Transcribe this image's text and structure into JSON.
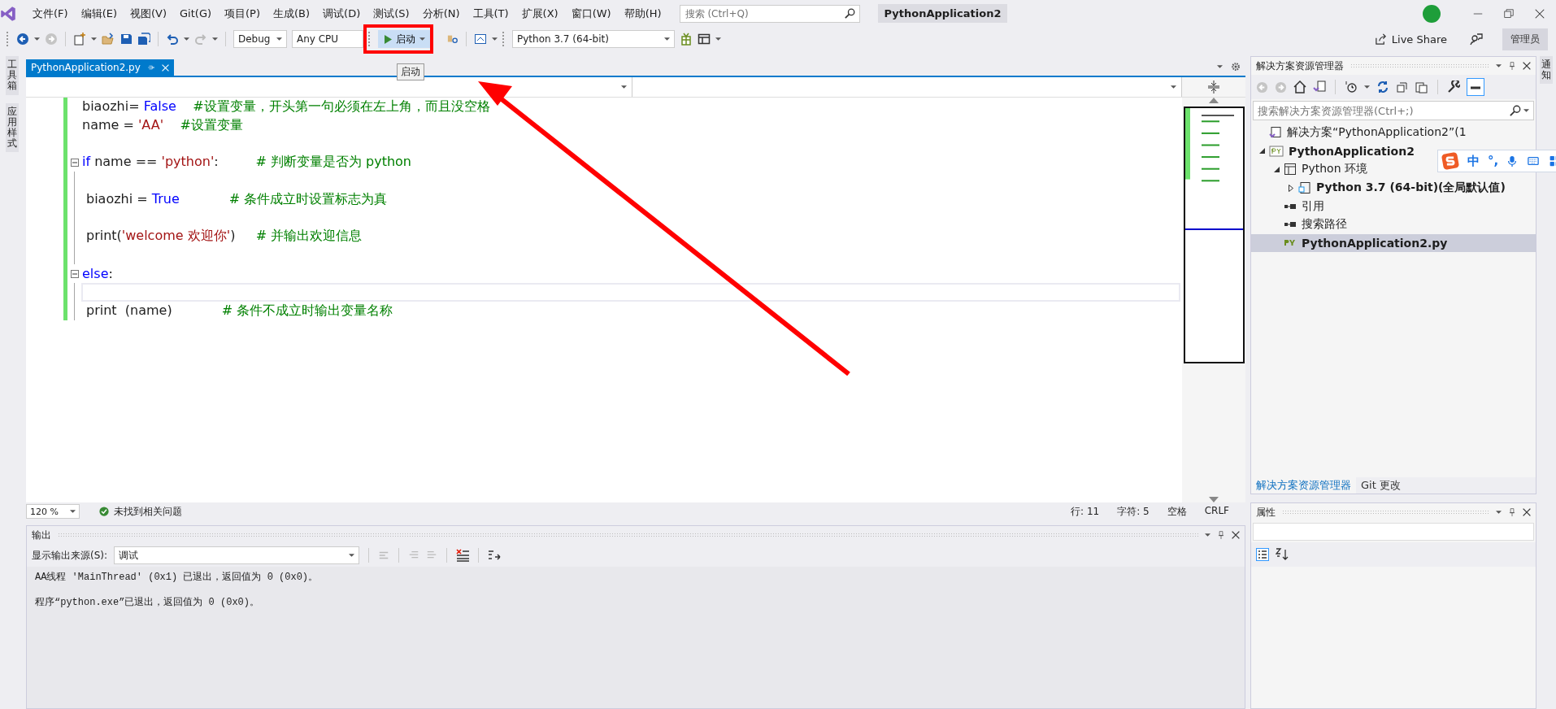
{
  "menu": [
    "文件(F)",
    "编辑(E)",
    "视图(V)",
    "Git(G)",
    "项目(P)",
    "生成(B)",
    "调试(D)",
    "测试(S)",
    "分析(N)",
    "工具(T)",
    "扩展(X)",
    "窗口(W)",
    "帮助(H)"
  ],
  "search": {
    "placeholder": "搜索 (Ctrl+Q)"
  },
  "window": {
    "title": "PythonApplication2"
  },
  "account": {
    "live_share": "Live Share",
    "admin": "管理员"
  },
  "toolbar": {
    "configuration": "Debug",
    "platform": "Any CPU",
    "start": "启动",
    "environment": "Python 3.7 (64-bit)"
  },
  "tooltip": "启动",
  "left_strip": [
    "工具箱",
    "应用样式"
  ],
  "right_strip": [
    "通知"
  ],
  "editor": {
    "tabs": [
      {
        "label": "PythonApplication2.py",
        "selected": true
      }
    ],
    "lines": [
      {
        "current": false,
        "fold": false,
        "block": false,
        "tokens": [
          {
            "kind": "plain",
            "text": "biaozhi= "
          },
          {
            "kind": "keyword",
            "text": "False"
          },
          {
            "kind": "comment",
            "text": "    #设置变量，开头第一句必须在左上角，而且没空格"
          }
        ]
      },
      {
        "current": false,
        "fold": false,
        "block": false,
        "tokens": [
          {
            "kind": "plain",
            "text": "name = "
          },
          {
            "kind": "string",
            "text": "'AA'"
          },
          {
            "kind": "comment",
            "text": "    #设置变量"
          }
        ]
      },
      {
        "current": false,
        "fold": false,
        "block": false
      },
      {
        "current": false,
        "fold": true,
        "block": false,
        "tokens": [
          {
            "kind": "keyword",
            "text": "if"
          },
          {
            "kind": "plain",
            "text": " name == "
          },
          {
            "kind": "string",
            "text": "'python'"
          },
          {
            "kind": "plain",
            "text": ":"
          },
          {
            "kind": "comment",
            "text": "         # 判断变量是否为 python"
          }
        ]
      },
      {
        "current": false,
        "fold": false,
        "block": true
      },
      {
        "current": false,
        "fold": false,
        "block": true,
        "tokens": [
          {
            "kind": "plain",
            "text": "biaozhi = "
          },
          {
            "kind": "keyword",
            "text": "True"
          },
          {
            "kind": "comment",
            "text": "            # 条件成立时设置标志为真"
          }
        ]
      },
      {
        "current": false,
        "fold": false,
        "block": true
      },
      {
        "current": false,
        "fold": false,
        "block": true,
        "tokens": [
          {
            "kind": "plain",
            "text": "print("
          },
          {
            "kind": "string",
            "text": "'welcome 欢迎你'"
          },
          {
            "kind": "plain",
            "text": ")"
          },
          {
            "kind": "comment",
            "text": "     # 并输出欢迎信息"
          }
        ]
      },
      {
        "current": false,
        "fold": false,
        "block": true
      },
      {
        "current": false,
        "fold": true,
        "block": false,
        "tokens": [
          {
            "kind": "keyword",
            "text": "else"
          },
          {
            "kind": "plain",
            "text": ":"
          }
        ]
      },
      {
        "current": true,
        "fold": false,
        "block": true
      },
      {
        "current": false,
        "fold": false,
        "block": true,
        "tokens": [
          {
            "kind": "plain",
            "text": "print  (name)"
          },
          {
            "kind": "comment",
            "text": "            # 条件不成立时输出变量名称"
          }
        ]
      }
    ],
    "status": {
      "zoom": "120 %",
      "issues": "未找到相关问题",
      "line": "行: 11",
      "column": "字符: 5",
      "whitespace": "空格",
      "line_ending": "CRLF"
    }
  },
  "output": {
    "title": "输出",
    "source_label": "显示输出来源(S):",
    "source": "调试",
    "lines": [
      "AA线程 'MainThread' (0x1) 已退出，返回值为 0 (0x0)。",
      "程序“python.exe”已退出，返回值为 0 (0x0)。"
    ]
  },
  "solution_explorer": {
    "title": "解决方案资源管理器",
    "search": {
      "placeholder": "搜索解决方案资源管理器(Ctrl+;)"
    },
    "solution": {
      "label": "解决方案“PythonApplication2”(1"
    },
    "tree": [
      {
        "kind": "project",
        "label": "PythonApplication2",
        "bold": true,
        "selected": false,
        "expanded": true,
        "children": [
          {
            "kind": "environments",
            "label": "Python 环境",
            "bold": false,
            "selected": false,
            "expanded": true,
            "children": [
              {
                "kind": "interpreter",
                "label": "Python 3.7 (64-bit)(全局默认值)",
                "bold": true,
                "selected": false,
                "expanded": false
              }
            ]
          },
          {
            "kind": "references",
            "label": "引用",
            "bold": false,
            "selected": false
          },
          {
            "kind": "search_paths",
            "label": "搜索路径",
            "bold": false,
            "selected": false
          },
          {
            "kind": "file",
            "label": "PythonApplication2.py",
            "bold": true,
            "selected": true
          }
        ]
      }
    ],
    "tabs": [
      {
        "label": "解决方案资源管理器",
        "selected": true
      },
      {
        "label": "Git 更改",
        "selected": false
      }
    ]
  },
  "properties": {
    "title": "属性"
  },
  "ime_bar": {
    "mode": "中",
    "punctuation": "°,"
  }
}
